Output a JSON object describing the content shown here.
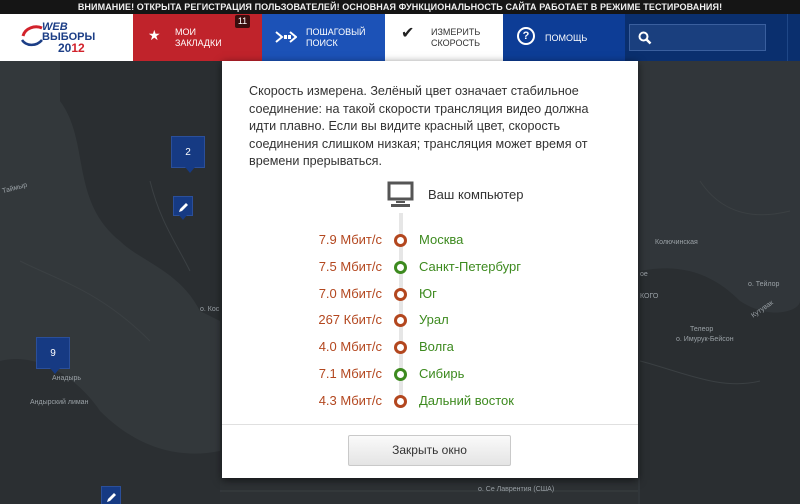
{
  "warning": "ВНИМАНИЕ! ОТКРЫТА РЕГИСТРАЦИЯ ПОЛЬЗОВАТЕЛЕЙ! ОСНОВНАЯ ФУНКЦИОНАЛЬНОСТЬ САЙТА РАБОТАЕТ В РЕЖИМЕ ТЕСТИРОВАНИЯ!",
  "logo": {
    "line1": "WEB",
    "line2": "ВЫБОРЫ",
    "year_prefix": "20",
    "year_suffix": "12"
  },
  "nav": {
    "bookmarks": {
      "line1": "МОИ",
      "line2": "ЗАКЛАДКИ",
      "badge": "11",
      "icon": "star-icon"
    },
    "search": {
      "line1": "ПОШАГОВЫЙ",
      "line2": "ПОИСК",
      "icon": "step-arrow-icon"
    },
    "speed": {
      "line1": "ИЗМЕРИТЬ",
      "line2": "СКОРОСТЬ",
      "icon": "checkmark-icon"
    },
    "help": {
      "label": "ПОМОЩЬ",
      "icon": "question-icon",
      "icon_glyph": "?"
    },
    "search_input": {
      "value": "",
      "placeholder": ""
    }
  },
  "map": {
    "markers": [
      {
        "count": "2"
      },
      {
        "count": "9"
      }
    ],
    "labels": [
      "Таймыр",
      "Анадырь",
      "Андырский лиман",
      "о. Кос",
      "Телеор",
      "Колючинская",
      "о. Имурук-Бейсон",
      "о. Се Лаврентия (США)",
      "КОГО",
      "ое",
      "о. Тейлор",
      "Кутувак"
    ]
  },
  "modal": {
    "description": "Скорость измерена. Зелёный цвет означает стабильное соединение: на такой скорости трансляция видео должна идти плавно. Если вы видите красный цвет, скорость соединения слишком низкая; трансляция может время от времени прерываться.",
    "computer_label": "Ваш компьютер",
    "close_label": "Закрыть окно",
    "colors": {
      "good": "#3d8a1f",
      "bad": "#b3471f"
    },
    "servers": [
      {
        "speed": "7.9 Мбит/с",
        "city": "Москва",
        "status": "bad"
      },
      {
        "speed": "7.5 Мбит/с",
        "city": "Санкт-Петербург",
        "status": "good"
      },
      {
        "speed": "7.0 Мбит/с",
        "city": "Юг",
        "status": "bad"
      },
      {
        "speed": "267 Кбит/с",
        "city": "Урал",
        "status": "bad"
      },
      {
        "speed": "4.0 Мбит/с",
        "city": "Волга",
        "status": "bad"
      },
      {
        "speed": "7.1 Мбит/с",
        "city": "Сибирь",
        "status": "good"
      },
      {
        "speed": "4.3 Мбит/с",
        "city": "Дальний восток",
        "status": "bad"
      }
    ]
  }
}
